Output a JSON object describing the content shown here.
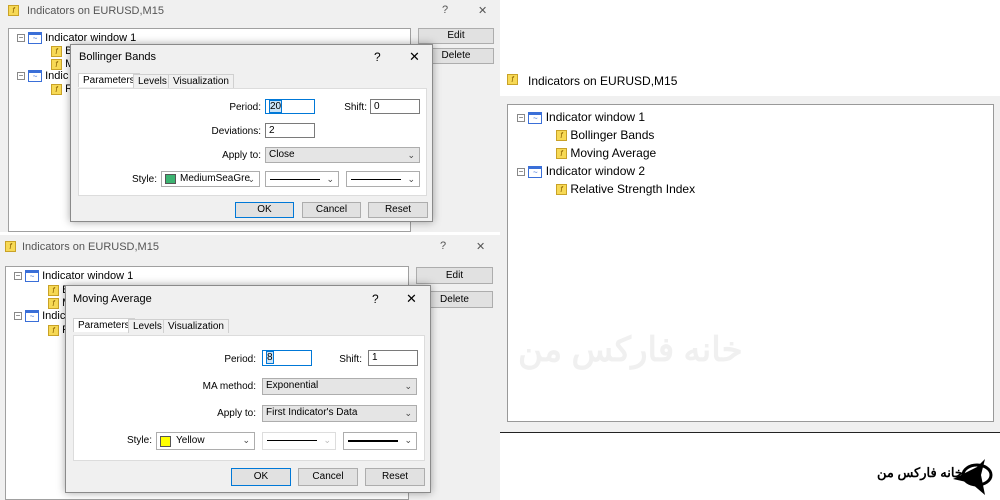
{
  "window_title": "Indicators on EURUSD,M15",
  "help": "?",
  "close": "✕",
  "edit_label": "Edit",
  "delete_label": "Delete",
  "tree": {
    "window1": "Indicator window 1",
    "bb": "Bollinger Bands",
    "ma": "Moving Average",
    "window2": "Indicator window 2",
    "rsi": "Relative Strength Index"
  },
  "tree_trunc": {
    "window1": "Indicator window 1",
    "b": "B",
    "m": "M",
    "window2": "Indic",
    "r": "R"
  },
  "tabs": [
    "Parameters",
    "Levels",
    "Visualization"
  ],
  "buttons": {
    "ok": "OK",
    "cancel": "Cancel",
    "reset": "Reset"
  },
  "bb_dialog": {
    "title": "Bollinger Bands",
    "period_label": "Period:",
    "period": "20",
    "shift_label": "Shift:",
    "shift": "0",
    "dev_label": "Deviations:",
    "dev": "2",
    "apply_label": "Apply to:",
    "apply": "Close",
    "style_label": "Style:",
    "color_name": "MediumSeaGre",
    "color": "#3cb371"
  },
  "ma_dialog": {
    "title": "Moving Average",
    "period_label": "Period:",
    "period": "8",
    "shift_label": "Shift:",
    "shift": "1",
    "method_label": "MA method:",
    "method": "Exponential",
    "apply_label": "Apply to:",
    "apply": "First Indicator's Data",
    "style_label": "Style:",
    "color_name": "Yellow",
    "color": "#ffff00"
  },
  "logo_text": "خانه فارکس من",
  "watermark": "خانه فارکس من"
}
